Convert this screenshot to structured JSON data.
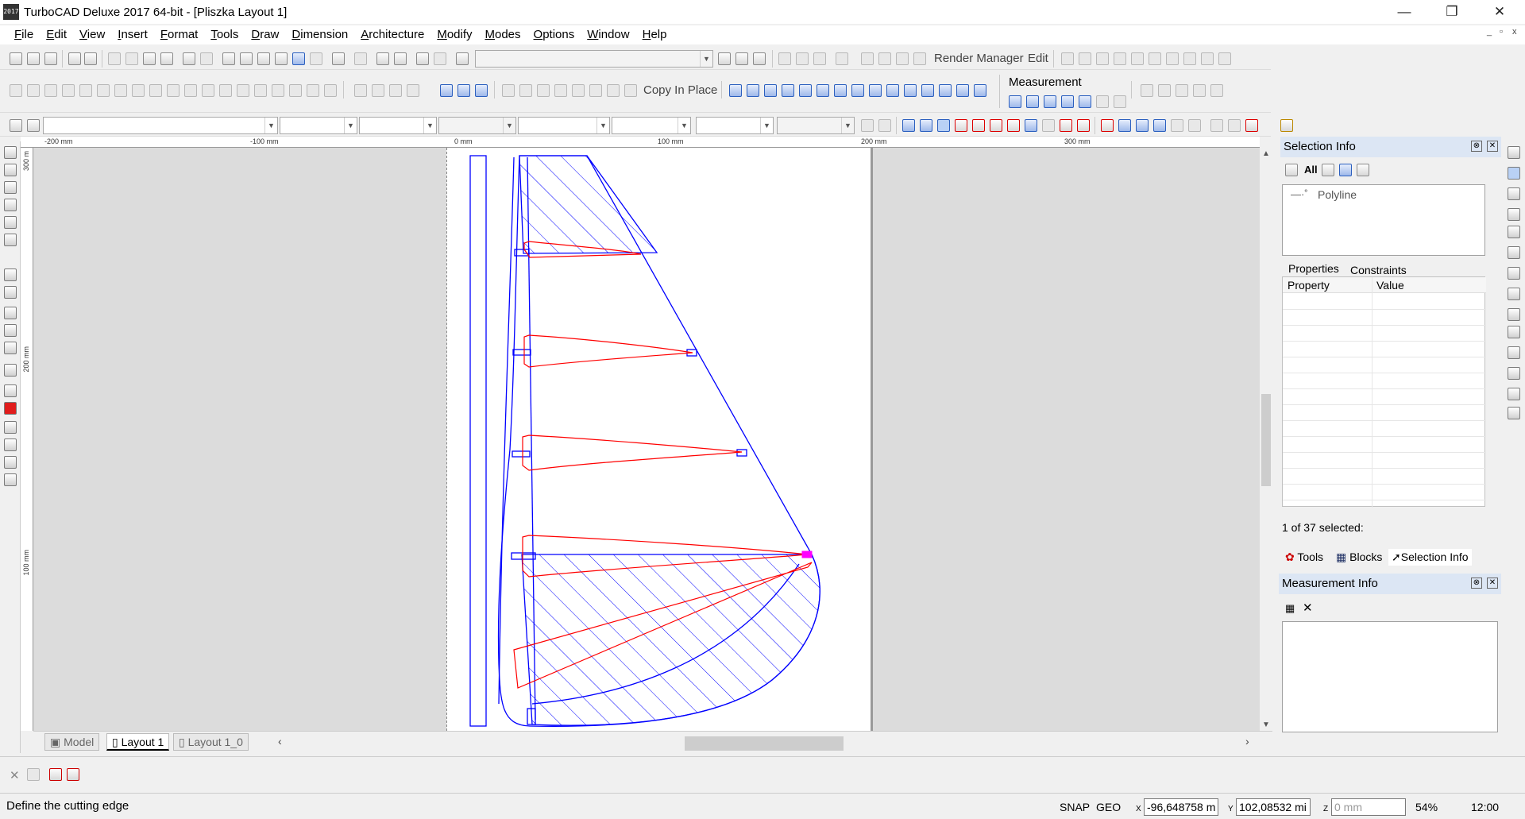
{
  "window": {
    "title": "TurboCAD Deluxe 2017 64-bit - [Pliszka Layout 1]",
    "app_icon_text": "2017",
    "minimize_glyph": "—",
    "maximize_glyph": "❐",
    "close_glyph": "✕"
  },
  "menu": [
    "File",
    "Edit",
    "View",
    "Insert",
    "Format",
    "Tools",
    "Draw",
    "Dimension",
    "Architecture",
    "Modify",
    "Modes",
    "Options",
    "Window",
    "Help"
  ],
  "mdi_controls": [
    "_",
    "▫",
    "x"
  ],
  "toolbar": {
    "render_manager_label": "Render Manager",
    "edit_label": "Edit",
    "copy_in_place_label": "Copy In Place",
    "measurement_label": "Measurement"
  },
  "ruler": {
    "top_labels": [
      "-200 mm",
      "-100 mm",
      "0 mm",
      "100 mm",
      "200 mm",
      "300 mm"
    ],
    "left_labels": [
      "300 m",
      "200 mm",
      "100 mm"
    ]
  },
  "tabs": {
    "model": "Model",
    "layout1": "Layout 1",
    "layout1_0": "Layout 1_0"
  },
  "selection_info": {
    "title": "Selection Info",
    "all_label": "All",
    "tree_item": "Polyline",
    "tab_properties": "Properties",
    "tab_constraints": "Constraints",
    "col_property": "Property",
    "col_value": "Value",
    "selected_count": "1 of 37 selected:",
    "bottom_tabs": [
      "Tools",
      "Blocks",
      "Selection Info"
    ]
  },
  "measurement_info": {
    "title": "Measurement Info"
  },
  "status": {
    "prompt": "Define the cutting edge",
    "snap": "SNAP",
    "geo": "GEO",
    "x_label": "X",
    "x_value": "-96,648758 m",
    "y_label": "Y",
    "y_value": "102,08532 mi",
    "z_label": "Z",
    "z_value": "0 mm",
    "zoom": "54%",
    "time": "12:00"
  },
  "colors": {
    "drawing_blue": "#0000ff",
    "drawing_red": "#ff0000",
    "drawing_magenta": "#ff00ff",
    "panel_title_bg": "#dce6f4"
  }
}
